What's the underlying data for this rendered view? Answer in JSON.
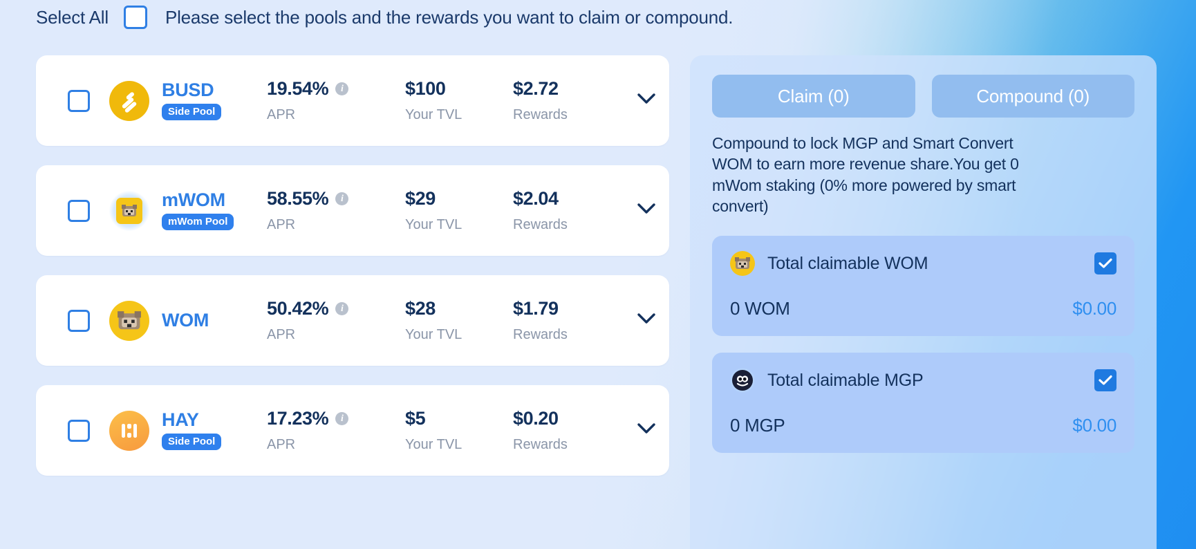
{
  "header": {
    "select_all_label": "Select All",
    "hint": "Please select the pools and the rewards you want to claim or compound."
  },
  "pools": [
    {
      "name": "BUSD",
      "icon": "busd-token-icon",
      "badge": "Side Pool",
      "apr_value": "19.54%",
      "apr_label": "APR",
      "tvl_value": "$100",
      "tvl_label": "Your TVL",
      "rewards_value": "$2.72",
      "rewards_label": "Rewards"
    },
    {
      "name": "mWOM",
      "icon": "mwom-token-icon",
      "badge": "mWom Pool",
      "apr_value": "58.55%",
      "apr_label": "APR",
      "tvl_value": "$29",
      "tvl_label": "Your TVL",
      "rewards_value": "$2.04",
      "rewards_label": "Rewards"
    },
    {
      "name": "WOM",
      "icon": "wom-token-icon",
      "badge": "",
      "apr_value": "50.42%",
      "apr_label": "APR",
      "tvl_value": "$28",
      "tvl_label": "Your TVL",
      "rewards_value": "$1.79",
      "rewards_label": "Rewards"
    },
    {
      "name": "HAY",
      "icon": "hay-token-icon",
      "badge": "Side Pool",
      "apr_value": "17.23%",
      "apr_label": "APR",
      "tvl_value": "$5",
      "tvl_label": "Your TVL",
      "rewards_value": "$0.20",
      "rewards_label": "Rewards"
    }
  ],
  "side_panel": {
    "claim_label": "Claim (0)",
    "compound_label": "Compound (0)",
    "compound_note": "Compound to lock MGP and Smart Convert WOM to earn more revenue share.You get 0 mWom staking (0% more powered by smart convert)",
    "claim_cards": [
      {
        "icon": "wom-token-icon",
        "title": "Total claimable WOM",
        "amount": "0 WOM",
        "usd": "$0.00",
        "checked": true
      },
      {
        "icon": "mgp-token-icon",
        "title": "Total claimable MGP",
        "amount": "0 MGP",
        "usd": "$0.00",
        "checked": true
      }
    ]
  },
  "colors": {
    "accent_blue": "#2f80ed",
    "text_dark": "#13315c",
    "muted": "#8a95a8",
    "usd_blue": "#2f8ff0",
    "card_bg": "#aecbfa",
    "token_yellow": "#f5c518"
  }
}
